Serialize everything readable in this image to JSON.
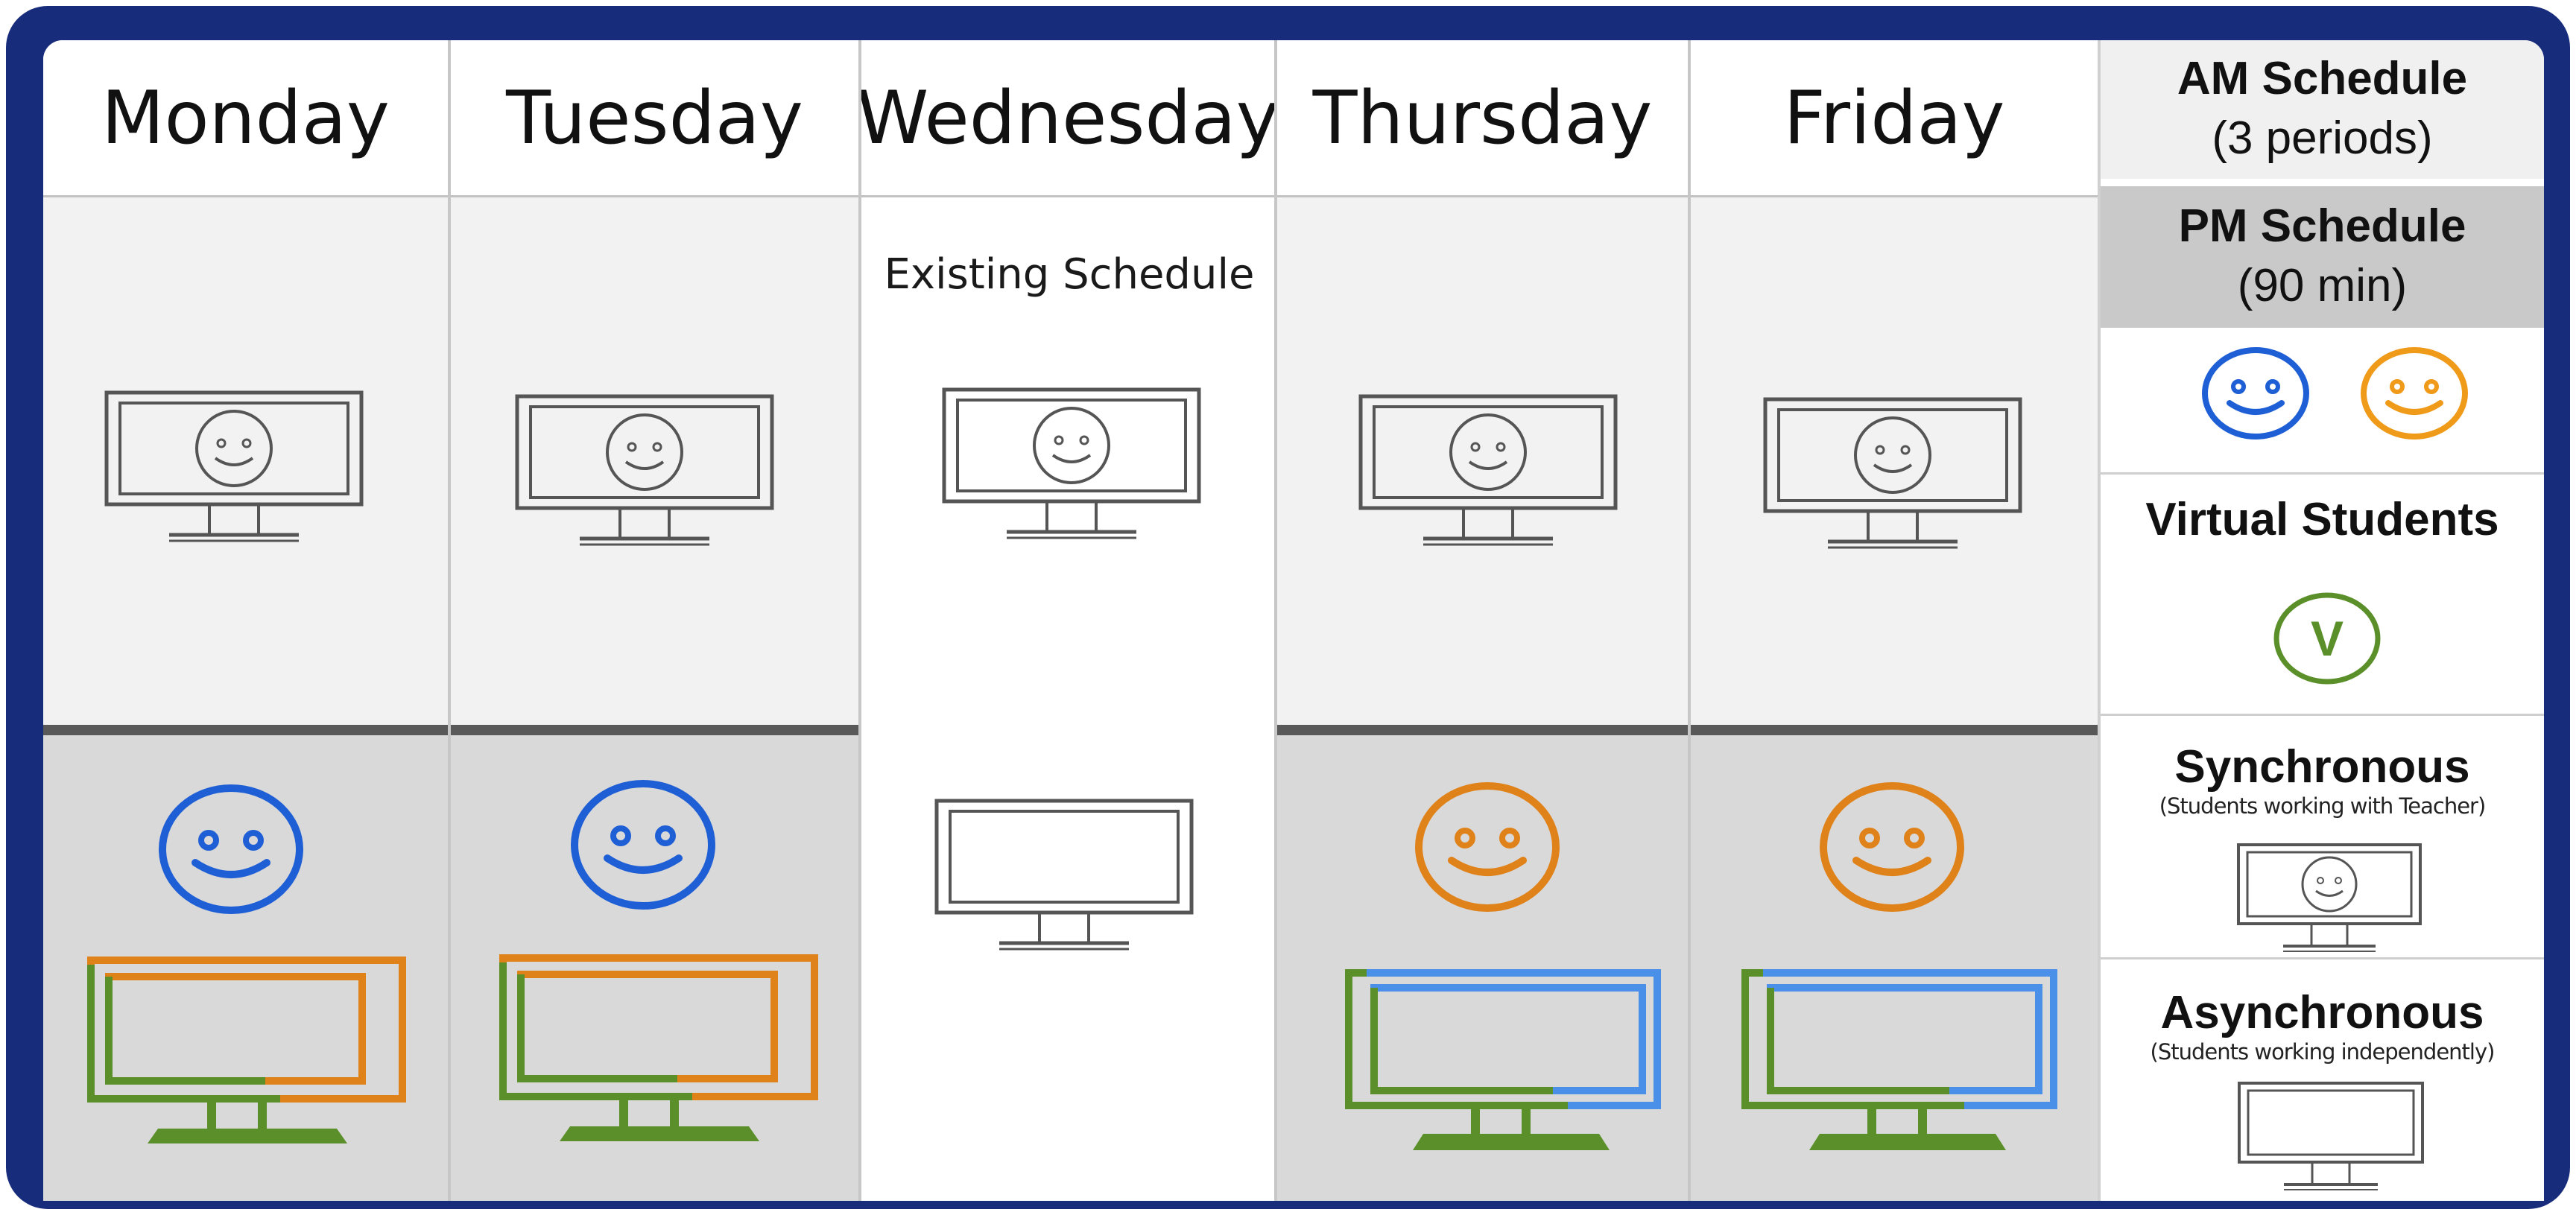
{
  "days": [
    {
      "name": "Monday"
    },
    {
      "name": "Tuesday"
    },
    {
      "name": "Wednesday"
    },
    {
      "name": "Thursday"
    },
    {
      "name": "Friday"
    }
  ],
  "wednesday_note": "Existing Schedule",
  "legend": {
    "am_title": "AM Schedule",
    "am_detail": "(3 periods)",
    "pm_title": "PM Schedule",
    "pm_detail": "(90 min)",
    "virtual_title": "Virtual Students",
    "virtual_badge": "V",
    "sync_title": "Synchronous",
    "sync_detail": "(Students working with Teacher)",
    "async_title": "Asynchronous",
    "async_detail": "(Students working independently)"
  },
  "colors": {
    "frame": "#182c7c",
    "blue_group": "#1f5fd6",
    "orange_group": "#f09a1a",
    "pm_orange_smiley": "#e0821a",
    "virtual_green": "#5a8f2a",
    "screen_blue": "#4a90e8",
    "screen_orange": "#e0821a",
    "monitor_gray": "#555555"
  },
  "icons": {
    "am_slots": "monitor-with-smiley-icon",
    "wednesday_pm": "blank-monitor-icon",
    "mon_tue_pm": [
      "blue-smiley-icon",
      "green-orange-monitor-icon"
    ],
    "thu_fri_pm": [
      "orange-smiley-icon",
      "green-blue-monitor-icon"
    ]
  }
}
